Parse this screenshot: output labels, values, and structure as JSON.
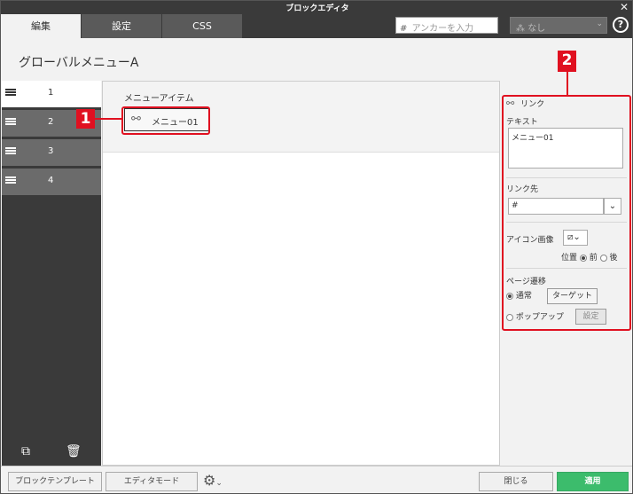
{
  "window": {
    "title": "ブロックエディタ",
    "close": "✕"
  },
  "tabs": [
    {
      "label": "編集"
    },
    {
      "label": "設定"
    },
    {
      "label": "CSS"
    }
  ],
  "anchor": {
    "hash": "#",
    "placeholder": "アンカーを入力"
  },
  "style_select": {
    "value": "なし"
  },
  "help": "?",
  "page_title": "グローバルメニューA",
  "left_list": [
    "1",
    "2",
    "3",
    "4"
  ],
  "center": {
    "heading": "メニューアイテム",
    "item_label": "メニュー01"
  },
  "right": {
    "link_title": "リンク",
    "text_label": "テキスト",
    "text_value": "メニュー01",
    "href_label": "リンク先",
    "href_value": "#",
    "icon_label": "アイコン画像",
    "position_label": "位置",
    "position_before": "前",
    "position_after": "後",
    "transition_label": "ページ遷移",
    "normal_label": "通常",
    "target_button": "ターゲット",
    "popup_label": "ポップアップ",
    "settings_button": "設定"
  },
  "callouts": [
    "1",
    "2"
  ],
  "footer": {
    "template_button": "ブロックテンプレート",
    "editor_mode_button": "エディタモード",
    "close_button": "閉じる",
    "apply_button": "適用"
  },
  "colors": {
    "accent": "#3cbc6c",
    "callout": "#e01020",
    "dark": "#3a3a3a"
  }
}
